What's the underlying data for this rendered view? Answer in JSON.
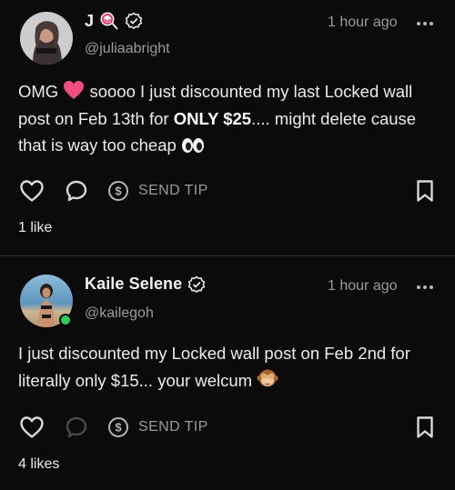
{
  "colors": {
    "background": "#0b0b0c",
    "text": "#e9e9ea",
    "muted": "#9a9a9f",
    "online": "#2ecc5a",
    "divider": "#2a2a2c"
  },
  "posts": [
    {
      "author": {
        "name": "J",
        "name_emoji": "lollipop-emoji",
        "verified_icon": "verified-badge-icon",
        "handle": "@juliaabright",
        "online": false
      },
      "time": "1 hour ago",
      "text": {
        "part1": "OMG ",
        "part2": " soooo I just discounted my last Locked wall post on Feb 13th for ",
        "bold": "ONLY $25",
        "part3": ".... might delete cause that is way too cheap ",
        "emoji_1": "heart-emoji",
        "emoji_2": "eyes-emoji"
      },
      "actions": {
        "like_icon": "heart-outline-icon",
        "comment_icon": "comment-bubble-icon",
        "tip_icon": "dollar-circle-icon",
        "tip_label": "SEND TIP",
        "bookmark_icon": "bookmark-icon"
      },
      "likes": "1 like"
    },
    {
      "author": {
        "name": "Kaile Selene",
        "verified_icon": "verified-badge-icon",
        "handle": "@kailegoh",
        "online": true
      },
      "time": "1 hour ago",
      "text": {
        "part1": "I just discounted my Locked wall post on Feb 2nd for literally only $15... your welcum ",
        "emoji_1": "see-no-evil-monkey-emoji"
      },
      "actions": {
        "like_icon": "heart-outline-icon",
        "comment_icon": "comment-bubble-icon",
        "tip_icon": "dollar-circle-icon",
        "tip_label": "SEND TIP",
        "bookmark_icon": "bookmark-icon"
      },
      "likes": "4 likes"
    }
  ]
}
